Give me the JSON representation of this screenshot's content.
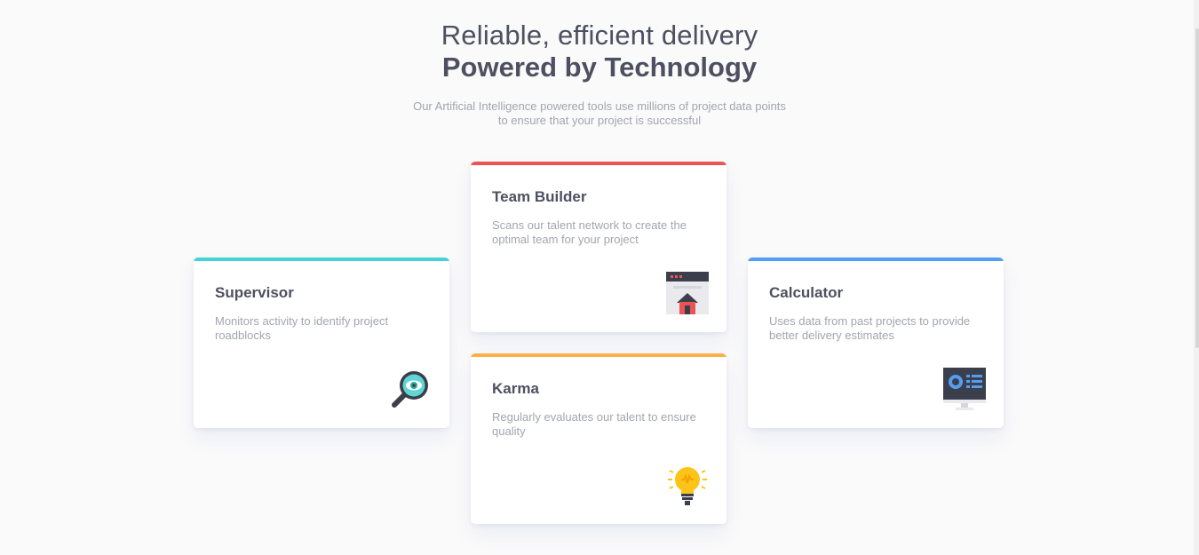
{
  "header": {
    "headline_light": "Reliable, efficient delivery",
    "headline_bold": "Powered by Technology",
    "intro": "Our Artificial Intelligence powered tools use millions of project data points to ensure that your project is successful"
  },
  "cards": [
    {
      "title": "Supervisor",
      "description": "Monitors activity to identify project roadblocks",
      "icon": "magnifier-eye-icon",
      "accent": "#44d3d2"
    },
    {
      "title": "Team Builder",
      "description": "Scans our talent network to create the optimal team for your project",
      "icon": "team-builder-icon",
      "accent": "#ea5454"
    },
    {
      "title": "Karma",
      "description": "Regularly evaluates our talent to ensure quality",
      "icon": "lightbulb-icon",
      "accent": "#fcaf4a"
    },
    {
      "title": "Calculator",
      "description": "Uses data from past projects to provide better delivery estimates",
      "icon": "calculator-monitor-icon",
      "accent": "#549ef2"
    }
  ],
  "colors": {
    "background": "#fafafa",
    "text_dark": "#4d5061",
    "text_muted": "#a3a5b0"
  }
}
